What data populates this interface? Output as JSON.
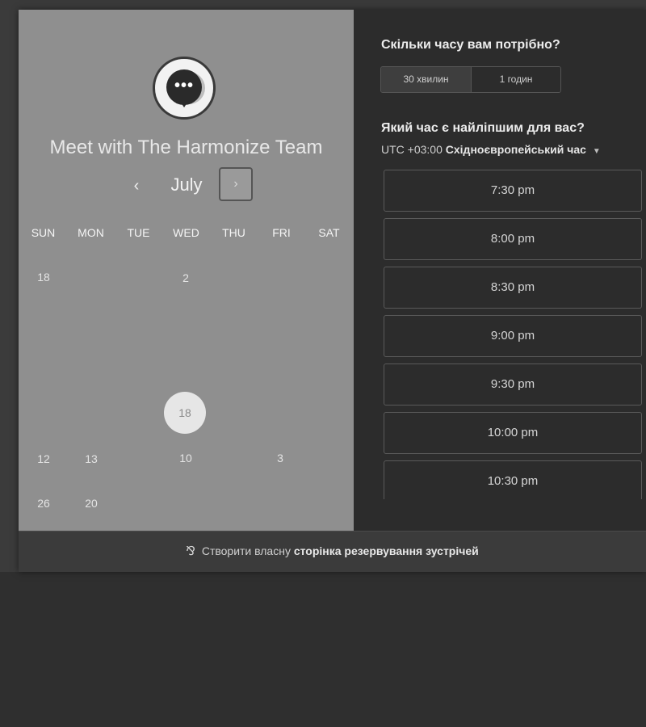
{
  "left": {
    "title": "Meet with The Harmonize Team",
    "month": "July",
    "prev_glyph": "‹",
    "next_glyph": "›",
    "weekdays": [
      "SUN",
      "MON",
      "TUE",
      "WED",
      "THU",
      "FRI",
      "SAT"
    ],
    "days": {
      "r1c1": "18",
      "r1c4": "2",
      "selected": "18",
      "r3c1": "12",
      "r3c2": "13",
      "r3c4": "10",
      "r3c6": "3",
      "r4c1": "26",
      "r4c2": "20"
    }
  },
  "right": {
    "question_duration": "Скільки часу вам потрібно?",
    "durations": [
      "30 хвилин",
      "1 годин"
    ],
    "selected_duration": "30 хвилин",
    "question_time": "Який час є найліпшим для вас?",
    "timezone_offset": "UTC +03:00",
    "timezone_name": "Східноєвропейський час",
    "slots": [
      "7:30 pm",
      "8:00 pm",
      "8:30 pm",
      "9:00 pm",
      "9:30 pm",
      "10:00 pm",
      "10:30 pm"
    ]
  },
  "footer": {
    "prefix": "Створити власну",
    "link": "сторінка резервування зустрічей"
  },
  "icons": {
    "logo": "chat-bubble-dots-icon",
    "footer": "sprocket-icon",
    "timezone": "caret-down-icon"
  }
}
